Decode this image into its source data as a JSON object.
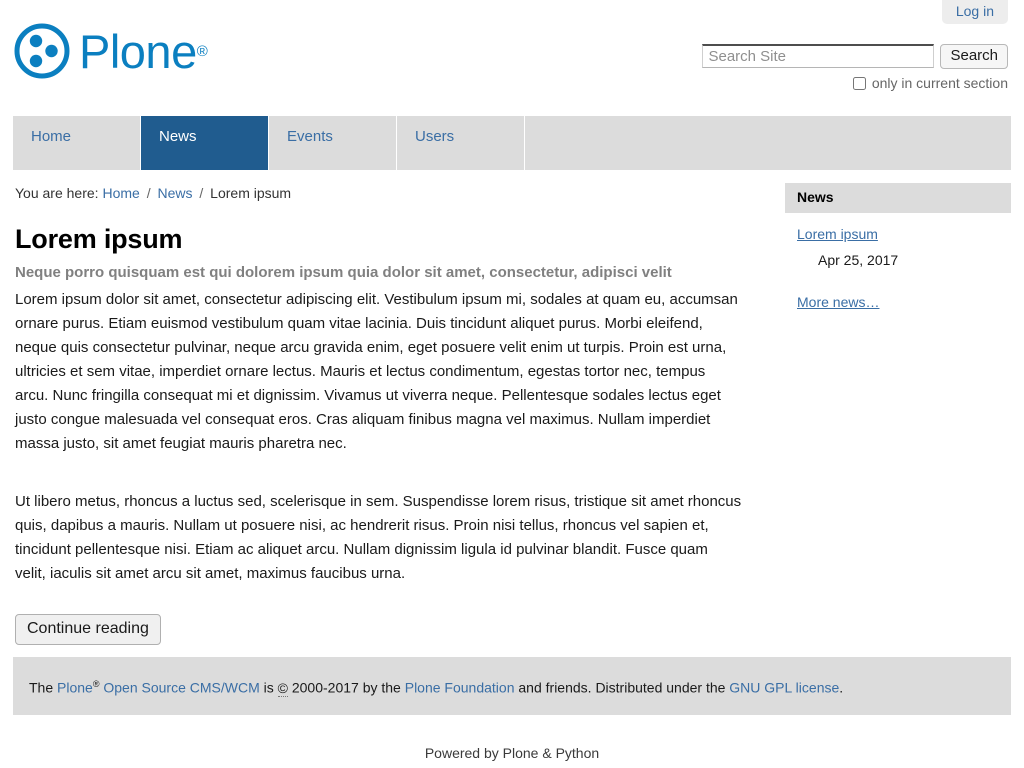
{
  "personal_bar": {
    "login_label": "Log in"
  },
  "branding": {
    "logo_word": "Plone",
    "logo_registered": "®",
    "logo_icon": "plone-logo-icon",
    "logo_color": "#0b7fc0"
  },
  "search": {
    "placeholder": "Search Site",
    "value": "",
    "button_label": "Search",
    "current_section_label": "only in current section",
    "current_section_checked": false
  },
  "globalnav": {
    "items": [
      {
        "label": "Home",
        "selected": false
      },
      {
        "label": "News",
        "selected": true
      },
      {
        "label": "Events",
        "selected": false
      },
      {
        "label": "Users",
        "selected": false
      }
    ],
    "selected_color": "#205c8f",
    "bar_color": "#dcdcdc"
  },
  "breadcrumb": {
    "prefix": "You are here:",
    "items": [
      "Home",
      "News"
    ],
    "separator": "/",
    "current": "Lorem ipsum"
  },
  "document": {
    "title": "Lorem ipsum",
    "description": "Neque porro quisquam est qui dolorem ipsum quia dolor sit amet, consectetur, adipisci velit",
    "paragraph_1": "Lorem ipsum dolor sit amet, consectetur adipiscing elit. Vestibulum ipsum mi, sodales at quam eu, accumsan ornare purus. Etiam euismod vestibulum quam vitae lacinia. Duis tincidunt aliquet purus. Morbi eleifend, neque quis consectetur pulvinar, neque arcu gravida enim, eget posuere velit enim ut turpis. Proin est urna, ultricies et sem vitae, imperdiet ornare lectus. Mauris et lectus condimentum, egestas tortor nec, tempus arcu. Nunc fringilla consequat mi et dignissim. Vivamus ut viverra neque. Pellentesque sodales lectus eget justo congue malesuada vel consequat eros. Cras aliquam finibus magna vel maximus. Nullam imperdiet massa justo, sit amet feugiat mauris pharetra nec.",
    "paragraph_2": "Ut libero metus, rhoncus a luctus sed, scelerisque in sem. Suspendisse lorem risus, tristique sit amet rhoncus quis, dapibus a mauris. Nullam ut posuere nisi, ac hendrerit risus. Proin nisi tellus, rhoncus vel sapien et, tincidunt pellentesque nisi. Etiam ac aliquet arcu. Nullam dignissim ligula id pulvinar blandit. Fusce quam velit, iaculis sit amet arcu sit amet, maximus faucibus urna.",
    "continue_label": "Continue reading"
  },
  "portlet_news": {
    "header": "News",
    "items": [
      {
        "title": "Lorem ipsum",
        "date": "Apr 25, 2017"
      }
    ],
    "more_label": "More news…"
  },
  "footer": {
    "colophon": {
      "lead": "The",
      "plone_link": "Plone",
      "registered": "®",
      "cms_link": "Open Source CMS/WCM",
      "is_word": "is",
      "copyright_symbol": "©",
      "years": "2000-2017",
      "by_the": "by the",
      "foundation_link": "Plone Foundation",
      "and_friends": "and friends. Distributed under the",
      "license_link": "GNU GPL license",
      "period": "."
    },
    "powered_by": "Powered by Plone & Python"
  }
}
